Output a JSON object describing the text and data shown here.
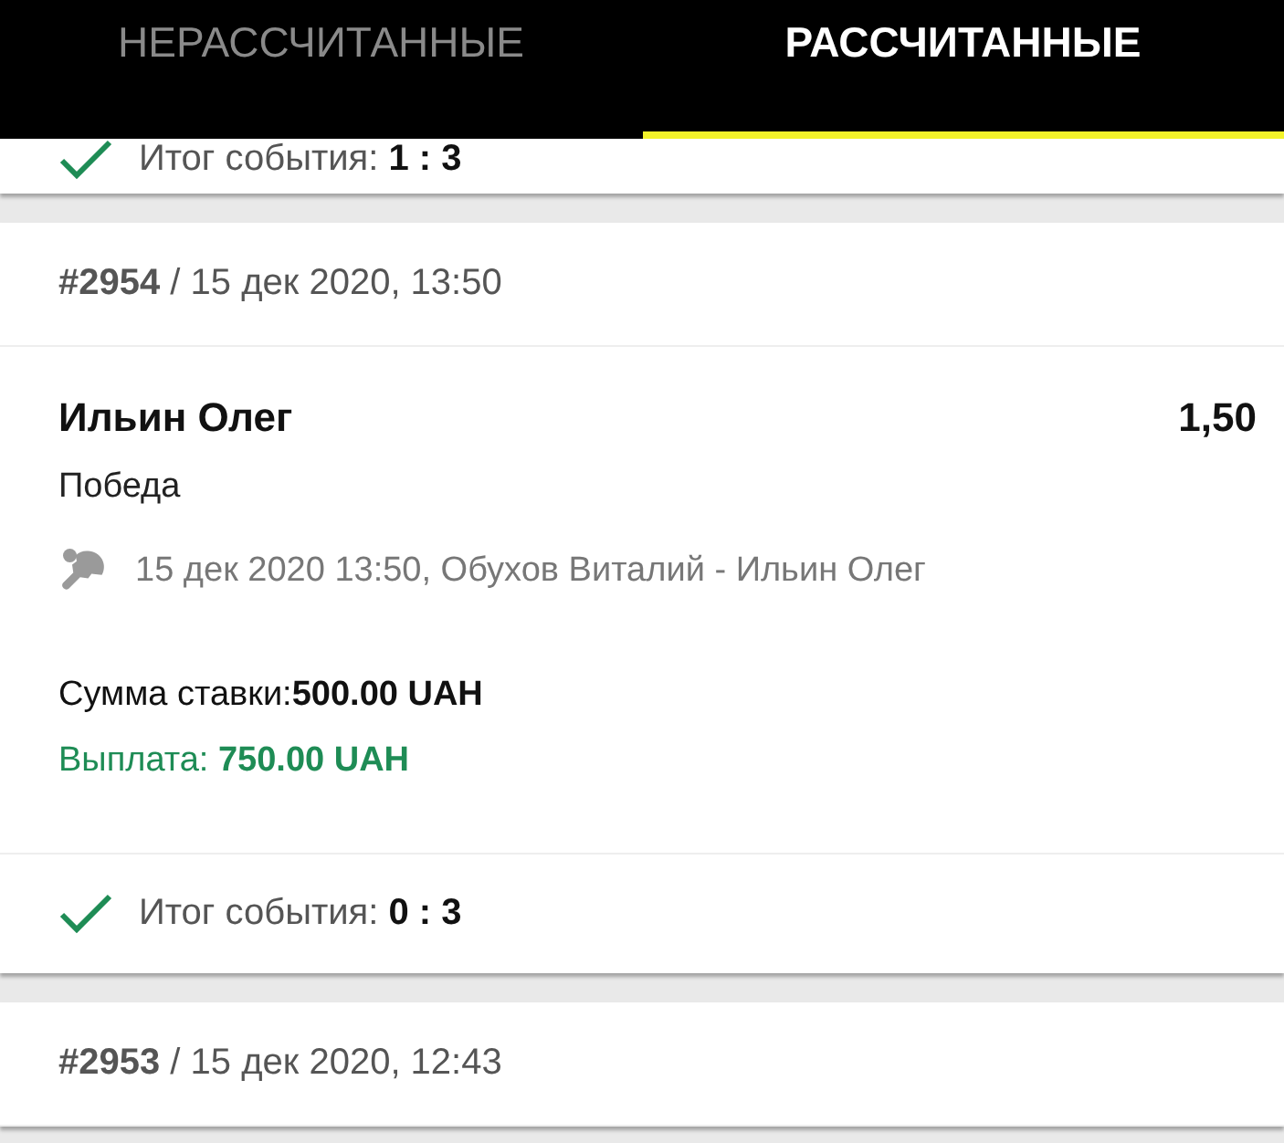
{
  "tabs": [
    {
      "label": "НЕРАССЧИТАННЫЕ",
      "selected": false
    },
    {
      "label": "РАССЧИТАННЫЕ",
      "selected": true
    }
  ],
  "bets": [
    {
      "result": "Итог события: **1 : 3**"
    },
    {
      "header": "**#2954** / 15 дек 2020, 13:50",
      "selection": "Ильин Олег",
      "odds": "1,50",
      "market": "Победа",
      "event": "15 дек 2020 13:50, Обухов Виталий - Ильин Олег",
      "stake": "Сумма ставки:**500.00 UAH**",
      "payout": "Выплата: **750.00 UAH**",
      "result": "Итог события: **0 : 3**"
    },
    {
      "header": "**#2953** / 15 дек 2020, 12:43"
    }
  ]
}
